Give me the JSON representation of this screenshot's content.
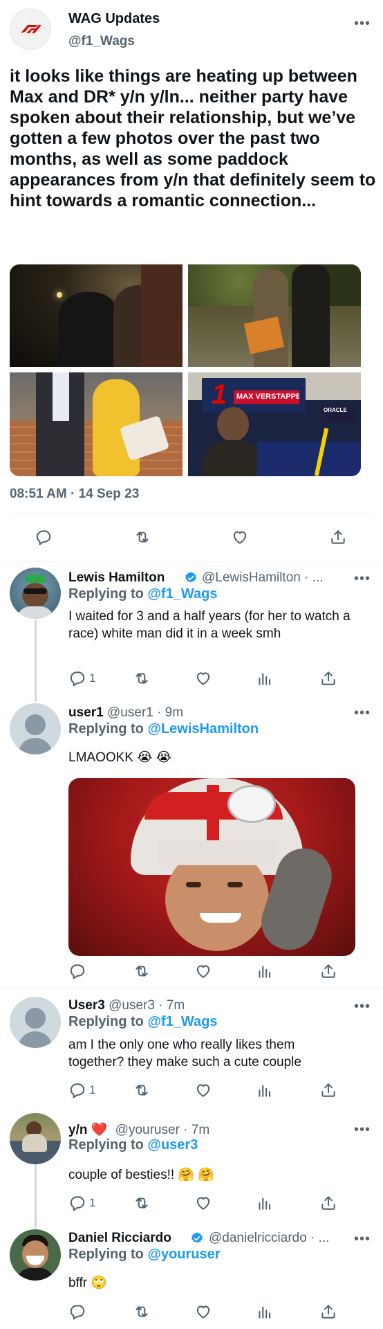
{
  "main_tweet": {
    "name": "WAG Updates",
    "handle": "@f1_Wags",
    "text": "it looks like things are heating up between Max and DR* y/n y/ln... neither party have spoken about their relationship, but we’ve gotten a few photos over the past two months, as well as some paddock appearances from y/n that definitely seem to hint towards a romantic connection...",
    "timestamp": "08:51 AM · 14 Sep 23",
    "banner_text": "MAX VERSTAPPEN",
    "banner_number": "1",
    "banner_side": "ORACLE"
  },
  "replies": [
    {
      "name": "Lewis Hamilton",
      "handle": "@LewisHamilton · ...",
      "replying_prefix": "Replying to",
      "replying_to": "@f1_Wags",
      "text": "I waited for 3 and a half years (for her to watch a race) white man did it in a week smh",
      "reply_count": "1"
    },
    {
      "name": "user1",
      "handle": "@user1 · 9m",
      "replying_prefix": "Replying to",
      "replying_to": "@LewisHamilton",
      "text": "LMAOOKK 😭 😭",
      "reply_count": ""
    },
    {
      "name": "User3",
      "handle": "@user3 · 7m",
      "replying_prefix": "Replying to",
      "replying_to": "@f1_Wags",
      "text": "am I the only one who really likes them together? they make such a cute couple",
      "reply_count": "1"
    },
    {
      "name": "y/n ❤️",
      "handle": "@youruser · 7m",
      "replying_prefix": "Replying to",
      "replying_to": "@user3",
      "text": "couple of besties!! 🤗 🤗",
      "reply_count": "1"
    },
    {
      "name": "Daniel Ricciardo",
      "handle": "@danielricciardo · ...",
      "replying_prefix": "Replying to",
      "replying_to": "@youruser",
      "text": "bffr 🙄",
      "reply_count": ""
    }
  ],
  "icons": {
    "more": "more-icon",
    "reply": "reply-icon",
    "retweet": "retweet-icon",
    "like": "like-icon",
    "views": "views-icon",
    "share": "share-icon",
    "verified": "verified-badge-icon"
  },
  "colors": {
    "accent": "#1d9bf0",
    "muted": "#536471",
    "text": "#0f1419",
    "f1_red": "#e10600"
  }
}
